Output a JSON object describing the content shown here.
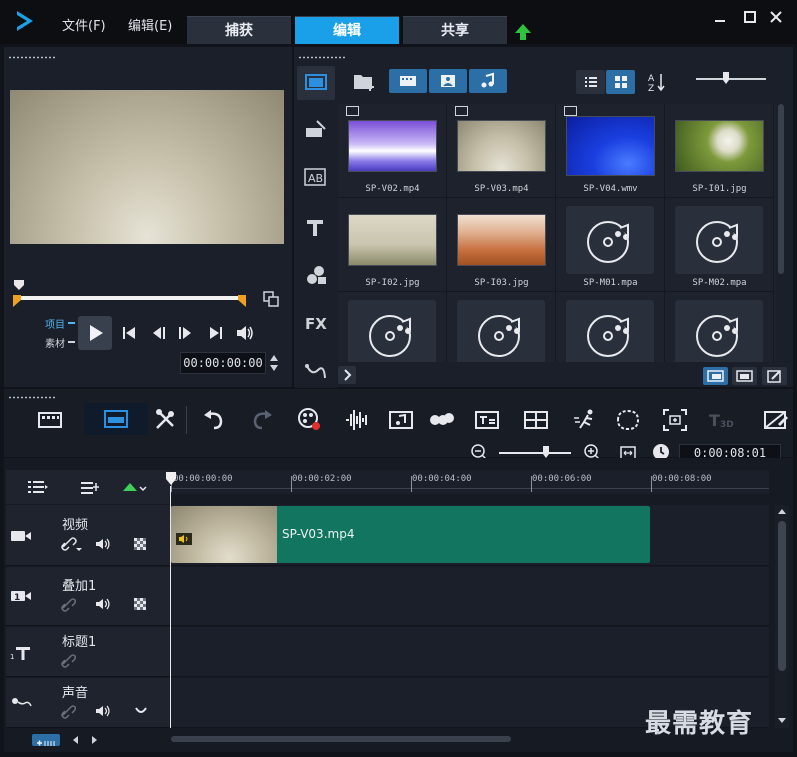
{
  "menu": {
    "file": "文件(F)",
    "edit": "编辑(E)"
  },
  "tabs": [
    {
      "label": "捕获"
    },
    {
      "label": "编辑"
    },
    {
      "label": "共享"
    }
  ],
  "preview": {
    "project_label": "项目",
    "clip_label": "素材",
    "timecode": "00:00:00:00"
  },
  "library": {
    "items": [
      {
        "name": "SP-V02.mp4",
        "type": "video"
      },
      {
        "name": "SP-V03.mp4",
        "type": "video"
      },
      {
        "name": "SP-V04.wmv",
        "type": "video"
      },
      {
        "name": "SP-I01.jpg",
        "type": "image"
      },
      {
        "name": "SP-I02.jpg",
        "type": "image"
      },
      {
        "name": "SP-I03.jpg",
        "type": "image"
      },
      {
        "name": "SP-M01.mpa",
        "type": "audio"
      },
      {
        "name": "SP-M02.mpa",
        "type": "audio"
      },
      {
        "name": "",
        "type": "audio"
      },
      {
        "name": "",
        "type": "audio"
      },
      {
        "name": "",
        "type": "audio"
      },
      {
        "name": "",
        "type": "audio"
      }
    ]
  },
  "timeline": {
    "duration": "0:00:08:01",
    "ruler": [
      "00:00:00:00",
      "00:00:02:00",
      "00:00:04:00",
      "00:00:06:00",
      "00:00:08:00"
    ],
    "tracks": [
      {
        "name": "视频"
      },
      {
        "name": "叠加1"
      },
      {
        "name": "标题1"
      },
      {
        "name": "声音"
      }
    ],
    "clip": {
      "label": "SP-V03.mp4"
    }
  },
  "watermark": "最需教育",
  "colors": {
    "accent": "#1aa0e8",
    "clip": "#127560",
    "background": "#10131a"
  }
}
